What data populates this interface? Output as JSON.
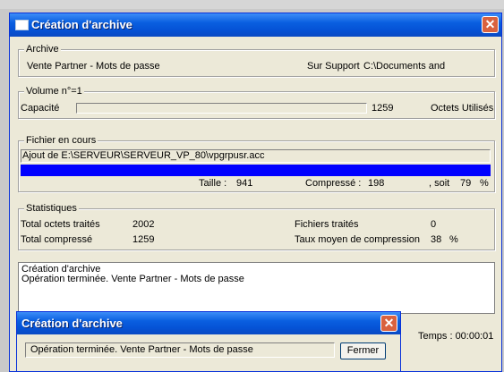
{
  "window": {
    "title": "Création d'archive",
    "close_label": "✕"
  },
  "archive": {
    "legend": "Archive",
    "name": "Vente Partner - Mots de passe",
    "support_label": "Sur Support",
    "support_path": "C:\\Documents and"
  },
  "volume": {
    "legend": "Volume n°=1",
    "capacity_label": "Capacité",
    "capacity_fill": 0,
    "bytes_used": "1259",
    "bytes_used_label": "Octets Utilisés"
  },
  "current_file": {
    "legend": "Fichier en cours",
    "path": "Ajout de E:\\SERVEUR\\SERVEUR_VP_80\\vpgrpusr.acc",
    "progress": 1.0,
    "size_label": "Taille :",
    "size_value": "941",
    "compressed_label": "Compressé :",
    "compressed_value": "198",
    "ratio_label": ", soit",
    "ratio_value": "79",
    "ratio_unit": "%"
  },
  "stats": {
    "legend": "Statistiques",
    "total_processed_label": "Total octets traités",
    "total_processed_value": "2002",
    "total_compressed_label": "Total compressé",
    "total_compressed_value": "1259",
    "files_label": "Fichiers traités",
    "files_value": "0",
    "avg_rate_label": "Taux moyen de compression",
    "avg_rate_value": "38",
    "avg_rate_unit": "%"
  },
  "log": {
    "lines": [
      "Création d'archive",
      "Opération terminée. Vente Partner - Mots de passe"
    ]
  },
  "time": {
    "label": "Temps : 00:00:01"
  },
  "dialog": {
    "title": "Création d'archive",
    "close_label": "✕",
    "message": "Opération terminée. Vente Partner - Mots de passe",
    "button_label": "Fermer"
  },
  "colors": {
    "titlebar": "#0553d6",
    "progress": "#0000ff",
    "face": "#ece9d8",
    "close": "#d9623f"
  }
}
